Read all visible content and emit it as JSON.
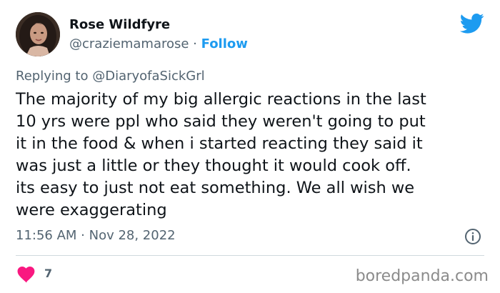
{
  "author": {
    "name": "Rose Wildfyre",
    "handle": "@craziemamarose",
    "separator": " · ",
    "follow_label": "Follow"
  },
  "icons": {
    "brand": "twitter-bird-icon",
    "info": "info-icon",
    "like": "heart-icon"
  },
  "reply": {
    "prefix": "Replying to ",
    "target": "@DiaryofaSickGrl"
  },
  "tweet": {
    "lines": [
      "The majority of my big allergic reactions in the last",
      "10 yrs were ppl who said they weren't going to put",
      "it in the food & when i started reacting they said it",
      "was just a little or they thought it would cook off.",
      "its easy to just not eat something. We all wish we",
      "were exaggerating"
    ],
    "timestamp": "11:56 AM · Nov 28, 2022",
    "likes": "7"
  },
  "watermark": "boredpanda.com",
  "colors": {
    "accent": "#1d9bf0",
    "text": "#0f1419",
    "secondary": "#536471",
    "like": "#f91880",
    "divider": "#cfd9de"
  }
}
